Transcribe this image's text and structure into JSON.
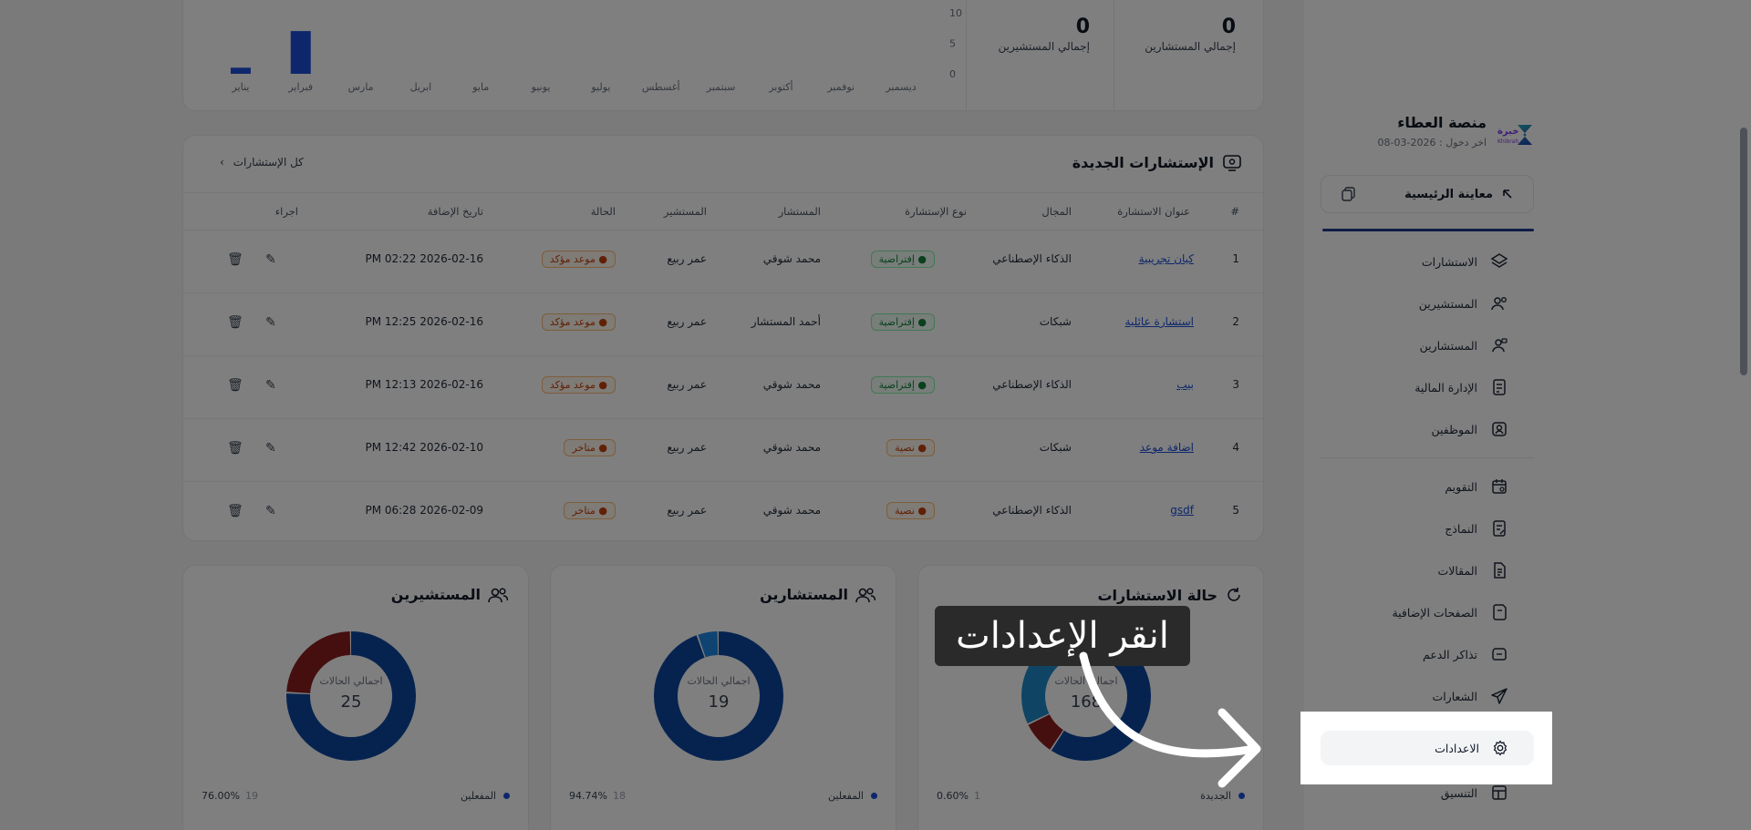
{
  "sidebar": {
    "brand_name": "منصة العطاء",
    "last_login": "اخر دخول : 2026-03-08",
    "logo_text": "خبرة",
    "logo_sub": "Khibrah",
    "preview_label": "معاينة الرئيسية",
    "items_top": [
      {
        "label": "الاستشارات",
        "icon": "layers-icon"
      },
      {
        "label": "المستشيرين",
        "icon": "users-icon"
      },
      {
        "label": "المستشارين",
        "icon": "consultant-icon"
      },
      {
        "label": "الإدارة المالية",
        "icon": "finance-icon"
      },
      {
        "label": "الموظفين",
        "icon": "employee-icon"
      }
    ],
    "items_bottom": [
      {
        "label": "التقويم",
        "icon": "calendar-icon"
      },
      {
        "label": "النماذج",
        "icon": "forms-icon"
      },
      {
        "label": "المقالات",
        "icon": "articles-icon"
      },
      {
        "label": "الصفحات الإضافية",
        "icon": "pages-icon"
      },
      {
        "label": "تذاكر الدعم",
        "icon": "support-icon"
      },
      {
        "label": "الشعارات",
        "icon": "send-icon"
      }
    ],
    "settings_label": "الاعدادات",
    "next_label": "التنسيق"
  },
  "chart_data": {
    "type": "bar",
    "categories": [
      "يناير",
      "فبراير",
      "مارس",
      "ابريل",
      "مايو",
      "يونيو",
      "يوليو",
      "أغسطس",
      "سبتمبر",
      "أكتوبر",
      "نوفمبر",
      "ديسمبر"
    ],
    "values": [
      1,
      7,
      0,
      0,
      0,
      0,
      0,
      0,
      0,
      0,
      0,
      0
    ],
    "yticks": [
      "10",
      "5",
      "0"
    ],
    "ylim": [
      0,
      10
    ],
    "color": "#1d4ed8"
  },
  "stats": [
    {
      "value": "0",
      "caption": "إجمالي المستشارين"
    },
    {
      "value": "0",
      "caption": "إجمالي المستشيرين"
    }
  ],
  "consultations": {
    "title": "الإستشارات الجديدة",
    "all_link": "كل الإستشارات",
    "columns": [
      "#",
      "عنوان الاستشارة",
      "المجال",
      "نوع الإستشارة",
      "المستشار",
      "المستشير",
      "الحالة",
      "تاريخ الإضافة",
      "اجراء"
    ],
    "rows": [
      {
        "num": "1",
        "title": "كيان تجريبية",
        "field": "الذكاء الإصطناعي",
        "type": "إفتراضية",
        "type_kind": "green",
        "consultant": "محمد شوقي",
        "client": "عمر ربيع",
        "status": "موعد مؤكد",
        "date": "PM 02:22 2026-02-16"
      },
      {
        "num": "2",
        "title": "استشارة عائلية",
        "field": "شبكات",
        "type": "إفتراضية",
        "type_kind": "green",
        "consultant": "أحمد المستشار",
        "client": "عمر ربيع",
        "status": "موعد مؤكد",
        "date": "PM 12:25 2026-02-16"
      },
      {
        "num": "3",
        "title": "بيب",
        "field": "الذكاء الإصطناعي",
        "type": "إفتراضية",
        "type_kind": "green",
        "consultant": "محمد شوقي",
        "client": "عمر ربيع",
        "status": "موعد مؤكد",
        "date": "PM 12:13 2026-02-16"
      },
      {
        "num": "4",
        "title": "اضافة موعد",
        "field": "شبكات",
        "type": "نصية",
        "type_kind": "orange",
        "consultant": "محمد شوقي",
        "client": "عمر ربيع",
        "status": "متاخر",
        "date": "PM 12:42 2026-02-10"
      },
      {
        "num": "5",
        "title": "gsdf",
        "field": "الذكاء الإصطناعي",
        "type": "نصية",
        "type_kind": "orange",
        "consultant": "محمد شوقي",
        "client": "عمر ربيع",
        "status": "متاخر",
        "date": "PM 06:28 2026-02-09"
      }
    ]
  },
  "donuts": [
    {
      "title": "حالة الاستشارات",
      "center_label": "اجمالي الحالات",
      "total": "168",
      "legend_label": "الجديدة",
      "legend_count": "1",
      "legend_pct": "0.60%",
      "segments": [
        {
          "value": 0.6,
          "color": "#1e88e5"
        },
        {
          "value": 55,
          "color": "#0d47a1"
        },
        {
          "value": 8,
          "color": "#8b1e1e"
        },
        {
          "value": 30,
          "color": "#1e88c8"
        }
      ]
    },
    {
      "title": "المستشارين",
      "center_label": "اجمالي الحالات",
      "total": "19",
      "legend_label": "المفعلين",
      "legend_count": "18",
      "legend_pct": "94.74%",
      "segments": [
        {
          "value": 94.74,
          "color": "#0d47a1"
        },
        {
          "value": 5.26,
          "color": "#1e88e5"
        }
      ]
    },
    {
      "title": "المستشيرين",
      "center_label": "اجمالي الحالات",
      "total": "25",
      "legend_label": "المفعلين",
      "legend_count": "19",
      "legend_pct": "76.00%",
      "segments": [
        {
          "value": 76,
          "color": "#0d47a1"
        },
        {
          "value": 24,
          "color": "#8b1e1e"
        }
      ]
    }
  ],
  "tooltip": {
    "text": "انقر الإعدادات"
  },
  "colors": {
    "accent": "#1e3a8a",
    "overlay": "rgba(0,0,0,0.5)"
  }
}
